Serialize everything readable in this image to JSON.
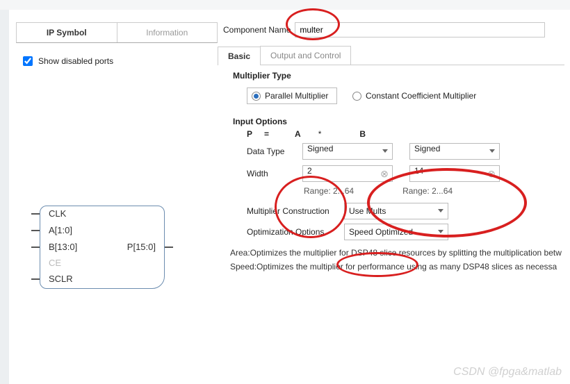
{
  "left": {
    "tabs": {
      "symbol": "IP Symbol",
      "info": "Information"
    },
    "show_disabled": "Show disabled ports",
    "show_disabled_checked": true,
    "ports": {
      "clk": "CLK",
      "a": "A[1:0]",
      "b": "B[13:0]",
      "ce": "CE",
      "sclr": "SCLR",
      "p": "P[15:0]"
    }
  },
  "right": {
    "cname_label": "Component Name",
    "cname_value": "multer",
    "tabs": {
      "basic": "Basic",
      "output": "Output and Control"
    },
    "mtype_title": "Multiplier Type",
    "radio_parallel": "Parallel Multiplier",
    "radio_const": "Constant Coefficient Multiplier",
    "input_opts": "Input Options",
    "eq": {
      "p": "P",
      "eq": "=",
      "a": "A",
      "star": "*",
      "b": "B"
    },
    "datatype_lbl": "Data Type",
    "width_lbl": "Width",
    "a_type": "Signed",
    "b_type": "Signed",
    "a_width": "2",
    "b_width": "14",
    "range_a": "Range: 2...64",
    "range_b": "Range: 2...64",
    "mconstr_lbl": "Multiplier Construction",
    "mconstr_val": "Use Mults",
    "optopts_lbl": "Optimization Options",
    "optopts_val": "Speed Optimized",
    "note_area": "Area:Optimizes the multiplier for DSP48 slice resources by splitting the multiplication betw",
    "note_speed": "Speed:Optimizes the multiplier for performance using as many DSP48 slices as necessa"
  },
  "watermark": "CSDN @fpga&matlab"
}
